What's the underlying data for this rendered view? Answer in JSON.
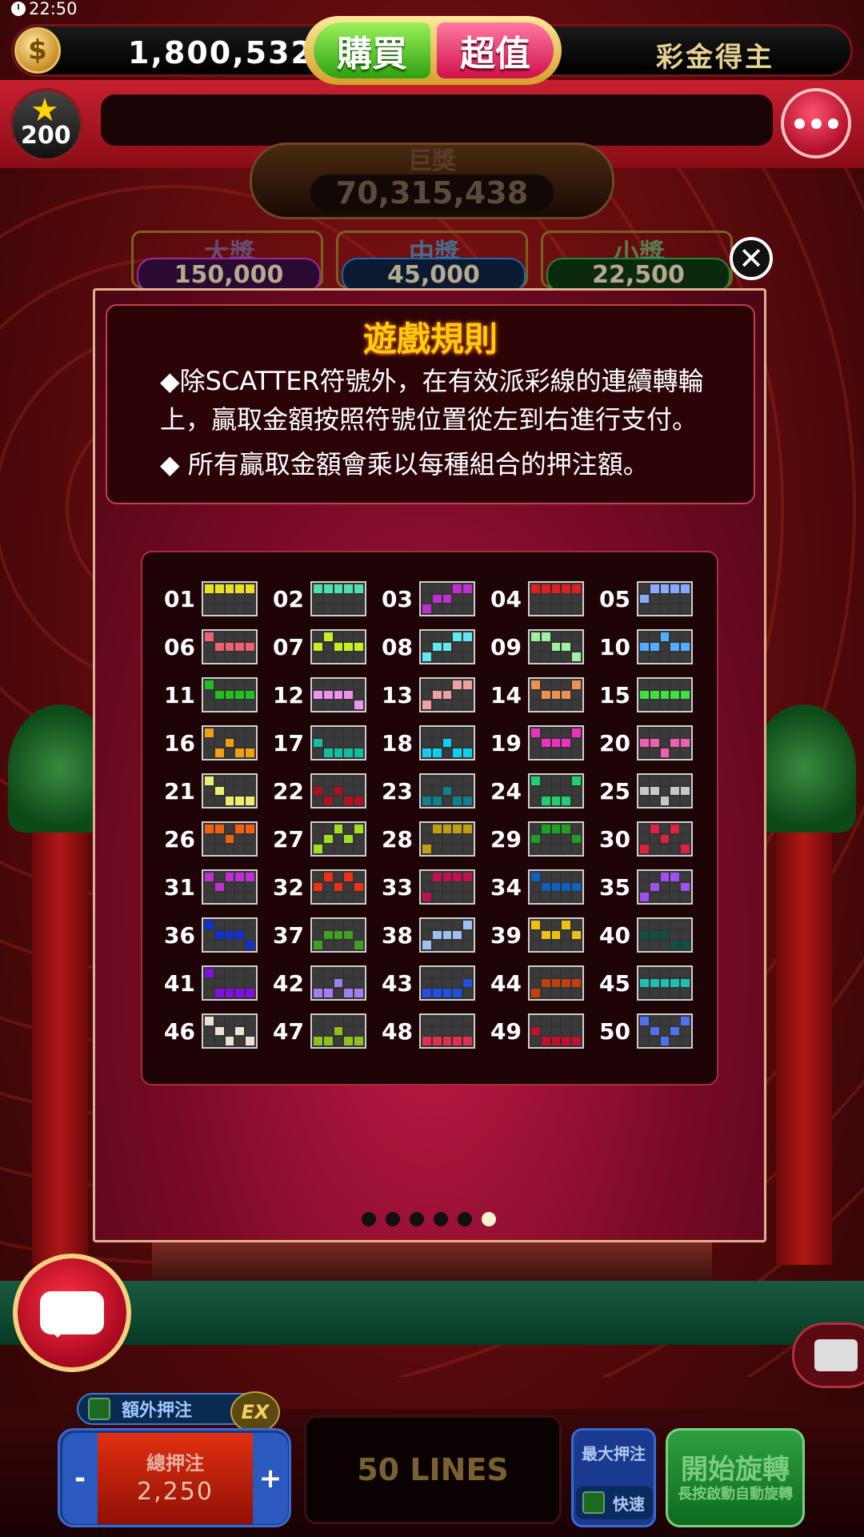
{
  "status_bar": {
    "time": "22:50"
  },
  "top_bar": {
    "balance": "1,800,532",
    "buy_label": "購買",
    "value_label": "超值",
    "winners_label": "彩金得主"
  },
  "level_badge": {
    "value": "200"
  },
  "jackpots": {
    "grand": {
      "label": "巨獎",
      "value": "70,315,438"
    },
    "tiers": [
      {
        "label": "大獎",
        "value": "150,000",
        "color": "#9a2aa0"
      },
      {
        "label": "中獎",
        "value": "45,000",
        "color": "#1a6ab0"
      },
      {
        "label": "小獎",
        "value": "22,500",
        "color": "#1a8a3a"
      }
    ]
  },
  "modal": {
    "title": "遊戲規則",
    "rules": [
      {
        "line1": "◆除SCATTER符號外，在有效派彩線的連續轉輪",
        "line2": "上，贏取金額按照符號位置從左到右進行支付。"
      },
      {
        "line1": "◆ 所有贏取金額會乘以每種組合的押注額。",
        "line2": ""
      }
    ],
    "paylines": [
      {
        "num": "01",
        "color": "#e8e020",
        "cells": [
          0,
          0,
          0,
          0,
          0
        ]
      },
      {
        "num": "02",
        "color": "#50e0b0",
        "cells": [
          0,
          0,
          0,
          0,
          0
        ]
      },
      {
        "num": "03",
        "color": "#c030d0",
        "cells": [
          2,
          1,
          1,
          0,
          0
        ]
      },
      {
        "num": "04",
        "color": "#e02020",
        "cells": [
          0,
          0,
          0,
          0,
          0
        ]
      },
      {
        "num": "05",
        "color": "#8aa8ff",
        "cells": [
          1,
          0,
          0,
          0,
          0
        ]
      },
      {
        "num": "06",
        "color": "#f06070",
        "cells": [
          0,
          1,
          1,
          1,
          1
        ]
      },
      {
        "num": "07",
        "color": "#c8f020",
        "cells": [
          1,
          0,
          1,
          1,
          1
        ]
      },
      {
        "num": "08",
        "color": "#60e8f0",
        "cells": [
          2,
          1,
          1,
          0,
          0
        ]
      },
      {
        "num": "09",
        "color": "#a0f0a0",
        "cells": [
          0,
          0,
          1,
          1,
          2
        ]
      },
      {
        "num": "10",
        "color": "#50b0ff",
        "cells": [
          1,
          1,
          0,
          1,
          1
        ]
      },
      {
        "num": "11",
        "color": "#20c020",
        "cells": [
          0,
          1,
          1,
          1,
          1
        ]
      },
      {
        "num": "12",
        "color": "#f090f0",
        "cells": [
          1,
          1,
          1,
          1,
          2
        ]
      },
      {
        "num": "13",
        "color": "#f0a0a0",
        "cells": [
          2,
          1,
          1,
          0,
          0
        ]
      },
      {
        "num": "14",
        "color": "#f09050",
        "cells": [
          0,
          1,
          1,
          1,
          0
        ]
      },
      {
        "num": "15",
        "color": "#40e040",
        "cells": [
          1,
          1,
          1,
          1,
          1
        ]
      },
      {
        "num": "16",
        "color": "#f0a010",
        "cells": [
          0,
          2,
          1,
          2,
          2
        ]
      },
      {
        "num": "17",
        "color": "#10c0a0",
        "cells": [
          1,
          2,
          2,
          2,
          2
        ]
      },
      {
        "num": "18",
        "color": "#10d0f0",
        "cells": [
          2,
          2,
          1,
          2,
          2
        ]
      },
      {
        "num": "19",
        "color": "#f030c0",
        "cells": [
          0,
          1,
          1,
          1,
          0
        ]
      },
      {
        "num": "20",
        "color": "#f060b0",
        "cells": [
          1,
          1,
          2,
          1,
          1
        ]
      },
      {
        "num": "21",
        "color": "#e8f070",
        "cells": [
          0,
          1,
          2,
          2,
          2
        ]
      },
      {
        "num": "22",
        "color": "#b01020",
        "cells": [
          1,
          2,
          1,
          2,
          2
        ]
      },
      {
        "num": "23",
        "color": "#108090",
        "cells": [
          2,
          2,
          1,
          2,
          2
        ]
      },
      {
        "num": "24",
        "color": "#20d070",
        "cells": [
          0,
          2,
          2,
          2,
          0
        ]
      },
      {
        "num": "25",
        "color": "#c8c8c8",
        "cells": [
          1,
          1,
          2,
          1,
          1
        ]
      },
      {
        "num": "26",
        "color": "#f06010",
        "cells": [
          0,
          0,
          1,
          0,
          0
        ]
      },
      {
        "num": "27",
        "color": "#a0e020",
        "cells": [
          2,
          1,
          0,
          1,
          0
        ]
      },
      {
        "num": "28",
        "color": "#c0a010",
        "cells": [
          2,
          0,
          0,
          0,
          0
        ]
      },
      {
        "num": "29",
        "color": "#20a020",
        "cells": [
          1,
          0,
          0,
          0,
          1
        ]
      },
      {
        "num": "30",
        "color": "#e02040",
        "cells": [
          2,
          0,
          1,
          0,
          2
        ]
      },
      {
        "num": "31",
        "color": "#c030d0",
        "cells": [
          0,
          1,
          0,
          0,
          0
        ]
      },
      {
        "num": "32",
        "color": "#f03010",
        "cells": [
          1,
          0,
          1,
          0,
          1
        ]
      },
      {
        "num": "33",
        "color": "#c01050",
        "cells": [
          2,
          0,
          0,
          0,
          0
        ]
      },
      {
        "num": "34",
        "color": "#1060c0",
        "cells": [
          0,
          1,
          1,
          1,
          1
        ]
      },
      {
        "num": "35",
        "color": "#a050f0",
        "cells": [
          2,
          1,
          0,
          0,
          1
        ]
      },
      {
        "num": "36",
        "color": "#1030d0",
        "cells": [
          0,
          1,
          1,
          1,
          2
        ]
      },
      {
        "num": "37",
        "color": "#40a020",
        "cells": [
          2,
          1,
          1,
          1,
          2
        ]
      },
      {
        "num": "38",
        "color": "#a0c0f0",
        "cells": [
          2,
          1,
          1,
          1,
          0
        ]
      },
      {
        "num": "39",
        "color": "#f0c010",
        "cells": [
          0,
          1,
          1,
          0,
          1
        ]
      },
      {
        "num": "40",
        "color": "#105040",
        "cells": [
          1,
          1,
          1,
          2,
          2
        ]
      },
      {
        "num": "41",
        "color": "#8010e0",
        "cells": [
          0,
          2,
          2,
          2,
          2
        ]
      },
      {
        "num": "42",
        "color": "#a080f0",
        "cells": [
          2,
          2,
          1,
          2,
          2
        ]
      },
      {
        "num": "43",
        "color": "#2050e0",
        "cells": [
          2,
          2,
          2,
          2,
          1
        ]
      },
      {
        "num": "44",
        "color": "#c04010",
        "cells": [
          2,
          1,
          1,
          1,
          1
        ]
      },
      {
        "num": "45",
        "color": "#20c0b0",
        "cells": [
          1,
          1,
          1,
          1,
          1
        ]
      },
      {
        "num": "46",
        "color": "#f0e0d0",
        "cells": [
          0,
          1,
          2,
          1,
          2
        ]
      },
      {
        "num": "47",
        "color": "#90c020",
        "cells": [
          2,
          2,
          1,
          2,
          2
        ]
      },
      {
        "num": "48",
        "color": "#e03050",
        "cells": [
          2,
          2,
          2,
          2,
          2
        ]
      },
      {
        "num": "49",
        "color": "#c01030",
        "cells": [
          1,
          2,
          2,
          2,
          2
        ]
      },
      {
        "num": "50",
        "color": "#5070f0",
        "cells": [
          0,
          1,
          2,
          1,
          0
        ]
      }
    ],
    "pages": 6,
    "active_page": 5
  },
  "bottom": {
    "extra_bet_label": "額外押注",
    "ex_badge": "EX",
    "total_bet_label": "總押注",
    "total_bet_value": "2,250",
    "minus": "-",
    "plus": "+",
    "lines_label": "50 LINES",
    "max_bet_label": "最大押注",
    "fast_label": "快速",
    "spin_label": "開始旋轉",
    "spin_sub": "長按啟動自動旋轉"
  }
}
